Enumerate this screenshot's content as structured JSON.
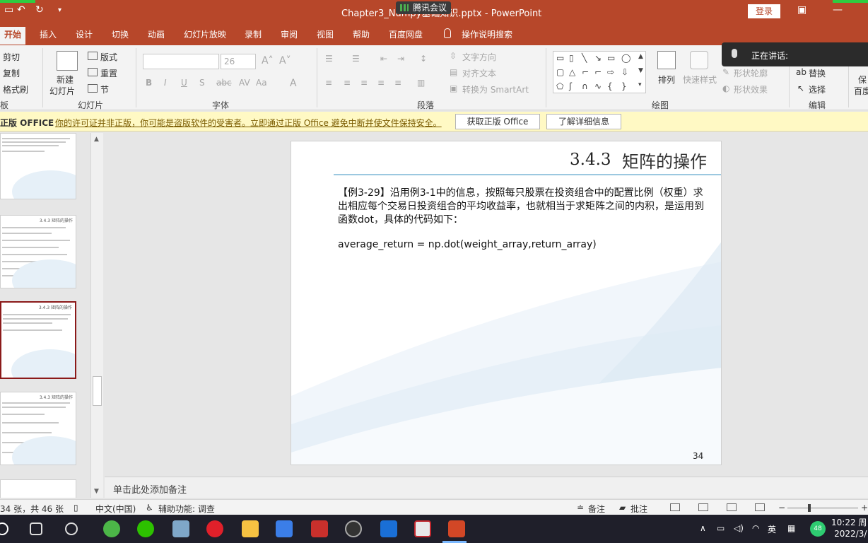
{
  "window": {
    "title": "Chapter3_Numpy基础知识.pptx  -  PowerPoint",
    "login": "登录",
    "meeting_label": "腾讯会议"
  },
  "tabs": [
    "开始",
    "插入",
    "设计",
    "切换",
    "动画",
    "幻灯片放映",
    "录制",
    "审阅",
    "视图",
    "帮助",
    "百度网盘",
    "操作说明搜索"
  ],
  "ribbon": {
    "clipboard": {
      "cut": "剪切",
      "copy": "复制",
      "format_painter": "格式刷",
      "group": "板"
    },
    "slides": {
      "new_slide": "新建",
      "new_slide2": "幻灯片",
      "layout": "版式",
      "reset": "重置",
      "section": "节",
      "group": "幻灯片"
    },
    "font": {
      "size": "26",
      "group": "字体"
    },
    "paragraph": {
      "text_direction": "文字方向",
      "align_text": "对齐文本",
      "smartart": "转换为 SmartArt",
      "group": "段落"
    },
    "drawing": {
      "arrange": "排列",
      "quick_styles": "快速样式",
      "shape_outline": "形状轮廓",
      "shape_effects": "形状效果",
      "group": "绘图"
    },
    "editing": {
      "replace": "替换",
      "select": "选择",
      "group": "编辑"
    },
    "save": {
      "label1": "保",
      "label2": "百度"
    }
  },
  "speaking": {
    "label": "正在讲话:"
  },
  "warning": {
    "brand": "正版 OFFICE",
    "message": "你的许可证并非正版，你可能是盗版软件的受害者。立即通过正版 Office 避免中断并使文件保持安全。",
    "get_genuine": "获取正版 Office",
    "learn_more": "了解详细信息"
  },
  "thumbnails": [
    {
      "title": ""
    },
    {
      "title": "3.4.3 矩阵的操作"
    },
    {
      "title": "3.4.3 矩阵的操作"
    },
    {
      "title": "3.4.3 矩阵的操作"
    },
    {
      "title": ""
    }
  ],
  "slide": {
    "section_number": "3.4.3",
    "section_title": "矩阵的操作",
    "paragraph": "【例3-29】沿用例3-1中的信息，按照每只股票在投资组合中的配置比例（权重）求出相应每个交易日投资组合的平均收益率，也就相当于求矩阵之间的内积，是运用到函数dot，具体的代码如下：",
    "code": "average_return = np.dot(weight_array,return_array)",
    "page_number": "34"
  },
  "notes": {
    "placeholder": "单击此处添加备注"
  },
  "status": {
    "slide_count": "34 张，共 46 张",
    "language": "中文(中国)",
    "accessibility": "辅助功能: 调查",
    "notes": "备注",
    "comments": "批注"
  },
  "taskbar": {
    "time": "10:22 周",
    "date": "2022/3/",
    "ime": "英",
    "badge": "48"
  },
  "colors": {
    "accent": "#b7472a",
    "warning_bg": "#fff9c4",
    "selected_thumb": "#8b1a1a"
  }
}
